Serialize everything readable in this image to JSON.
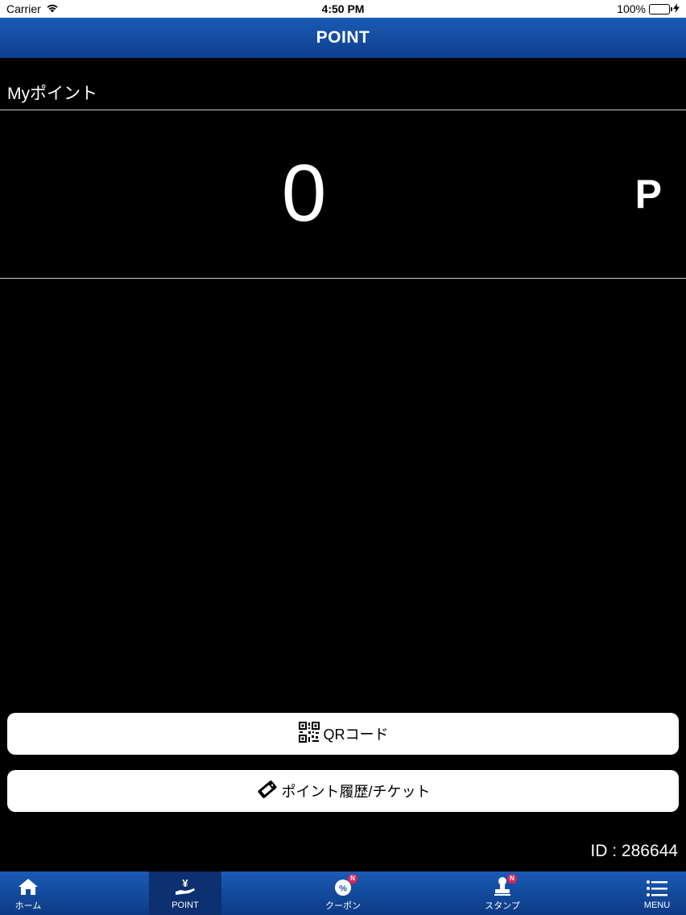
{
  "status_bar": {
    "carrier": "Carrier",
    "time": "4:50 PM",
    "battery_percent": "100%",
    "battery_level": 1.0
  },
  "header": {
    "title": "POINT"
  },
  "my_point": {
    "label": "Myポイント",
    "value": "0",
    "unit": "P"
  },
  "buttons": {
    "qr_code": "QRコード",
    "history": "ポイント履歴/チケット"
  },
  "user": {
    "id_text": "ID : 286644"
  },
  "tab_bar": {
    "items": [
      {
        "label": "ホーム",
        "icon": "home-icon",
        "active": false
      },
      {
        "label": "POINT",
        "icon": "yen-hand-icon",
        "active": true
      },
      {
        "label": "クーポン",
        "icon": "coupon-icon",
        "active": false,
        "badge": "N"
      },
      {
        "label": "スタンプ",
        "icon": "stamp-icon",
        "active": false,
        "badge": "N"
      },
      {
        "label": "MENU",
        "icon": "menu-icon",
        "active": false
      }
    ]
  },
  "colors": {
    "header_blue": "#1a5bb5",
    "badge": "#e0245e",
    "background": "#000000"
  }
}
